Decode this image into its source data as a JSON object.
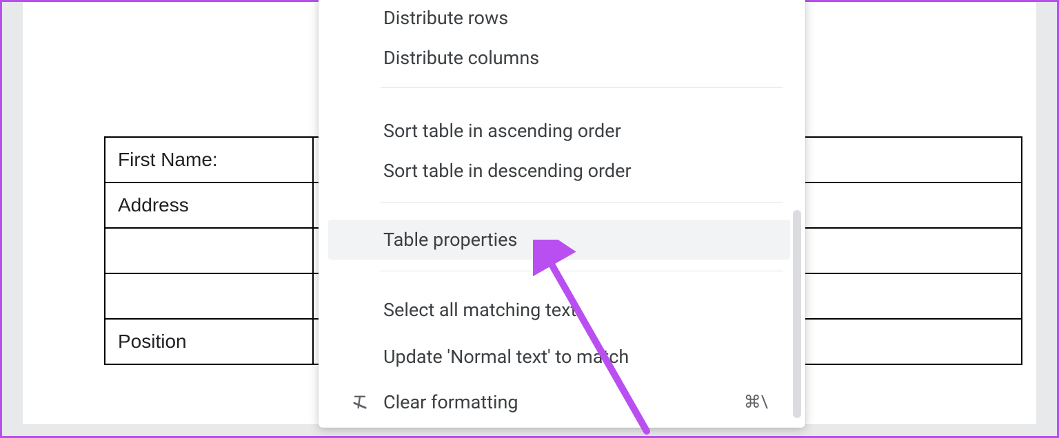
{
  "table": {
    "rows": [
      [
        "First Name:",
        "",
        "",
        ""
      ],
      [
        "Address",
        "|",
        "",
        ""
      ],
      [
        "",
        "",
        "",
        ""
      ],
      [
        "",
        "",
        "",
        ""
      ],
      [
        "Position",
        "",
        "",
        ""
      ]
    ]
  },
  "menu": {
    "distribute_rows": "Distribute rows",
    "distribute_columns": "Distribute columns",
    "sort_asc": "Sort table in ascending order",
    "sort_desc": "Sort table in descending order",
    "table_properties": "Table properties",
    "select_matching": "Select all matching text",
    "update_normal": "Update 'Normal text' to match",
    "clear_formatting": "Clear formatting",
    "clear_formatting_shortcut": "⌘\\"
  }
}
